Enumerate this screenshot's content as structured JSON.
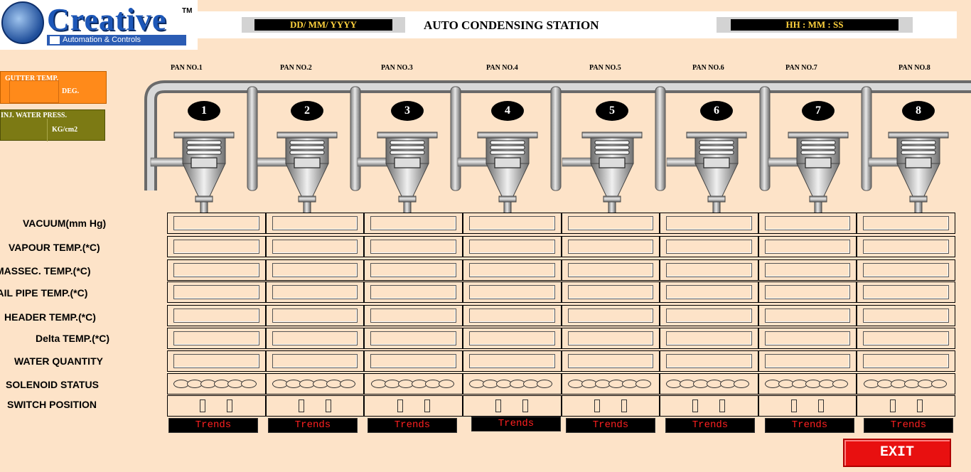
{
  "logo": {
    "name": "Creative",
    "tm": "TM",
    "subtitle": "Automation & Controls"
  },
  "header": {
    "date": "DD/ MM/ YYYY",
    "title": "AUTO CONDENSING STATION",
    "time": "HH : MM : SS"
  },
  "gutter": {
    "label": "GUTTER TEMP.",
    "unit": "DEG."
  },
  "water_press": {
    "label": "INJ. WATER PRESS.",
    "unit": "KG/cm2"
  },
  "pans": [
    {
      "label": "PAN NO.1",
      "num": "1"
    },
    {
      "label": "PAN NO.2",
      "num": "2"
    },
    {
      "label": "PAN NO.3",
      "num": "3"
    },
    {
      "label": "PAN NO.4",
      "num": "4"
    },
    {
      "label": "PAN NO.5",
      "num": "5"
    },
    {
      "label": "PAN NO.6",
      "num": "6"
    },
    {
      "label": "PAN NO.7",
      "num": "7"
    },
    {
      "label": "PAN NO.8",
      "num": "8"
    }
  ],
  "rows": [
    "VACUUM(mm Hg)",
    "VAPOUR TEMP.(*C)",
    "MASSEC. TEMP.(*C)",
    "TAIL PIPE TEMP.(*C)",
    "HEADER TEMP.(*C)",
    "Delta TEMP.(*C)",
    "WATER QUANTITY",
    "SOLENOID STATUS",
    "SWITCH POSITION"
  ],
  "trends_label": "Trends",
  "exit_label": "EXIT",
  "colors": {
    "background": "#fde3c8",
    "gutter": "#ff8a1a",
    "water": "#7c7a14",
    "exit": "#e81010",
    "trend_text": "#ff2020"
  }
}
